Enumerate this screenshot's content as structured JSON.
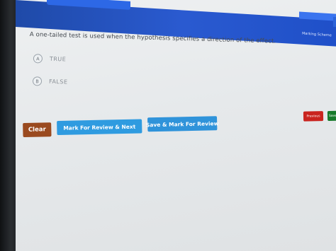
{
  "header": {
    "marking_scheme_label": "Marking Scheme"
  },
  "question": {
    "text": "A one-tailed test is used when the hypothesis specifies a direction of the effect.",
    "options": [
      {
        "letter": "A",
        "label": "TRUE"
      },
      {
        "letter": "B",
        "label": "FALSE"
      }
    ]
  },
  "actions": {
    "clear_label": "Clear",
    "mark_review_next_label": "Mark For Review & Next",
    "save_mark_review_label": "Save & Mark For Review",
    "previous_label": "Previous",
    "save_next_label": "Save"
  },
  "colors": {
    "header_blue": "#2a5ad0",
    "clear_brown": "#9a4a1f",
    "review_blue": "#2f9be0",
    "previous_red": "#c9241f",
    "save_green": "#167a2a"
  }
}
